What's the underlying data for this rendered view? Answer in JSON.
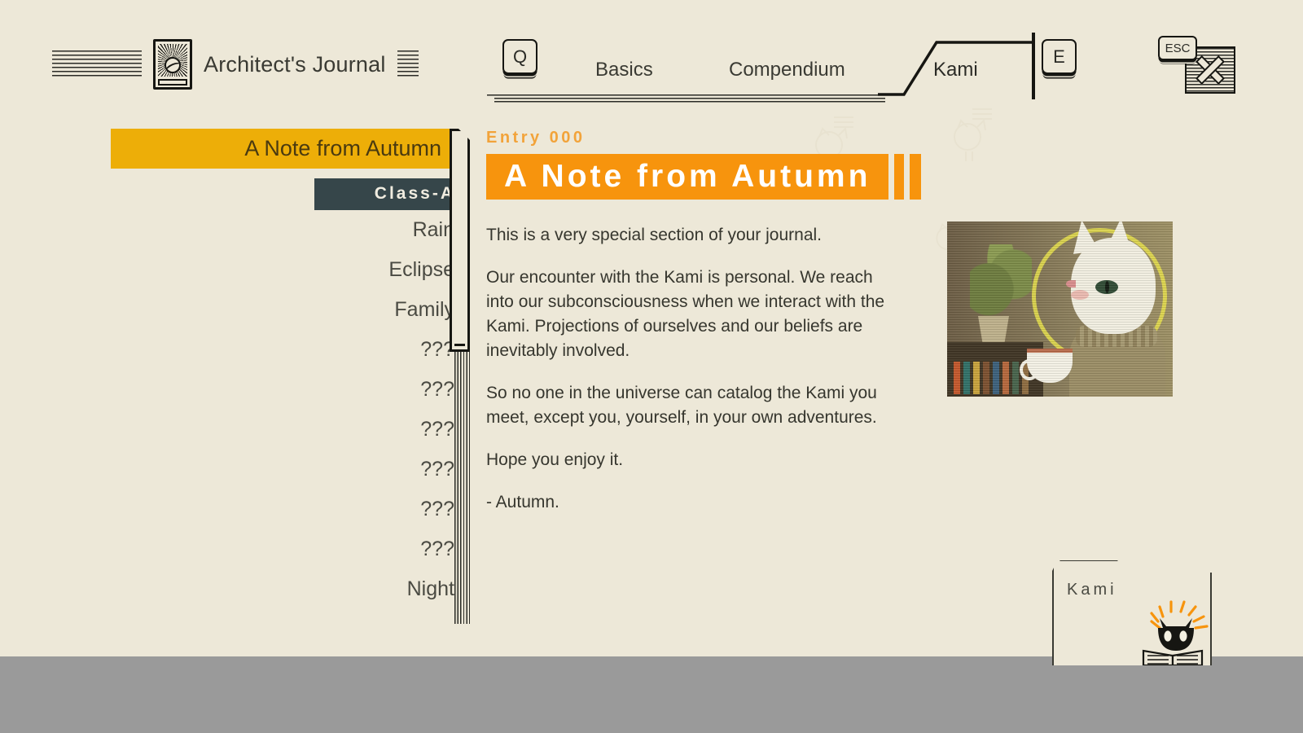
{
  "app": {
    "journal_title": "Architect's Journal",
    "book_icon": "journal-book-icon"
  },
  "header": {
    "keys": {
      "prev_key": "Q",
      "next_key": "E",
      "close_key": "ESC"
    },
    "close_icon": "close-x-icon",
    "tabs": [
      {
        "id": "basics",
        "label": "Basics",
        "active": false
      },
      {
        "id": "compendium",
        "label": "Compendium",
        "active": false
      },
      {
        "id": "kami",
        "label": "Kami",
        "active": true
      }
    ]
  },
  "sidebar": {
    "entries": [
      {
        "label": "A Note from Autumn",
        "type": "entry",
        "selected": true
      },
      {
        "label": "Class-A",
        "type": "class-header",
        "selected": false
      },
      {
        "label": "Rain",
        "type": "entry",
        "selected": false
      },
      {
        "label": "Eclipse",
        "type": "entry",
        "selected": false
      },
      {
        "label": "Family",
        "type": "entry",
        "selected": false
      },
      {
        "label": "???",
        "type": "entry",
        "selected": false
      },
      {
        "label": "???",
        "type": "entry",
        "selected": false
      },
      {
        "label": "???",
        "type": "entry",
        "selected": false
      },
      {
        "label": "???",
        "type": "entry",
        "selected": false
      },
      {
        "label": "???",
        "type": "entry",
        "selected": false
      },
      {
        "label": "???",
        "type": "entry",
        "selected": false
      },
      {
        "label": "Night",
        "type": "entry",
        "selected": false
      }
    ]
  },
  "content": {
    "entry_number": "Entry 000",
    "title": "A Note from Autumn",
    "paragraphs": [
      "This is a very special section of your journal.",
      "Our encounter with the Kami is personal. We reach into our  subconsciousness when we interact with the Kami. Projections of ourselves and our beliefs are inevitably involved.",
      "So no one in the universe can catalog the Kami you meet, except you, yourself, in your own adventures.",
      "Hope you enjoy it.",
      "- Autumn."
    ],
    "illustration_alt": "white-cat-with-halo-holding-teacup"
  },
  "folder": {
    "label": "Kami",
    "icon": "black-cat-reading-book-icon"
  },
  "colors": {
    "background": "#EDE8D8",
    "accent_orange": "#F7940D",
    "accent_yellow": "#EDAE08",
    "dark_chip": "#36464A",
    "ink": "#2B2B26",
    "body_text": "#36362E",
    "footer_gray": "#9A9A9A",
    "entry_number": "#F2A33A"
  }
}
